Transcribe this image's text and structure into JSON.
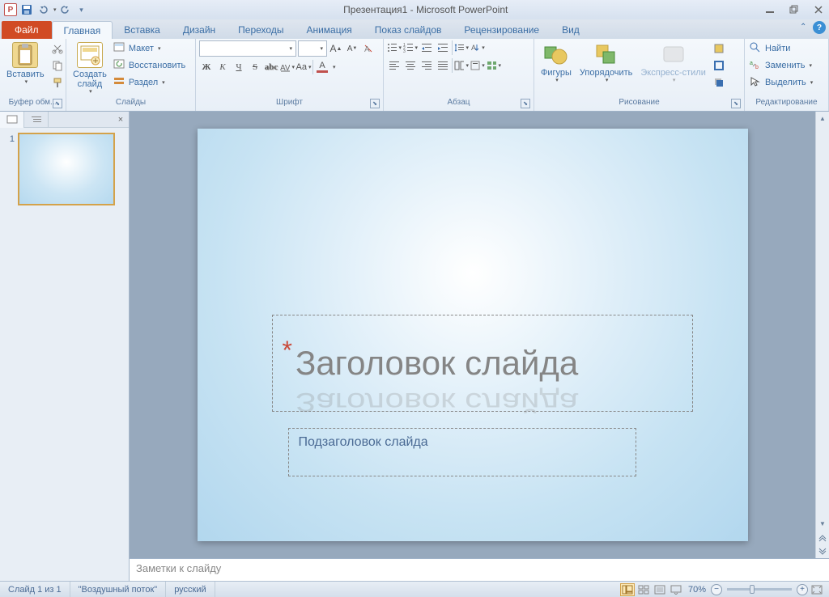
{
  "titlebar": {
    "title": "Презентация1 - Microsoft PowerPoint"
  },
  "tabs": {
    "file": "Файл",
    "items": [
      "Главная",
      "Вставка",
      "Дизайн",
      "Переходы",
      "Анимация",
      "Показ слайдов",
      "Рецензирование",
      "Вид"
    ],
    "active_index": 0
  },
  "ribbon": {
    "clipboard": {
      "paste": "Вставить",
      "label": "Буфер обм..."
    },
    "slides": {
      "new_slide": "Создать\nслайд",
      "layout": "Макет",
      "reset": "Восстановить",
      "section": "Раздел",
      "label": "Слайды"
    },
    "font": {
      "label": "Шрифт"
    },
    "paragraph": {
      "label": "Абзац"
    },
    "drawing": {
      "shapes": "Фигуры",
      "arrange": "Упорядочить",
      "quick_styles": "Экспресс-стили",
      "label": "Рисование"
    },
    "editing": {
      "find": "Найти",
      "replace": "Заменить",
      "select": "Выделить",
      "label": "Редактирование"
    }
  },
  "slide_panel": {
    "thumb_number": "1"
  },
  "slide": {
    "title_placeholder": "Заголовок слайда",
    "subtitle_placeholder": "Подзаголовок слайда"
  },
  "notes": {
    "placeholder": "Заметки к слайду"
  },
  "statusbar": {
    "slide_count": "Слайд 1 из 1",
    "theme": "\"Воздушный поток\"",
    "language": "русский",
    "zoom": "70%"
  }
}
